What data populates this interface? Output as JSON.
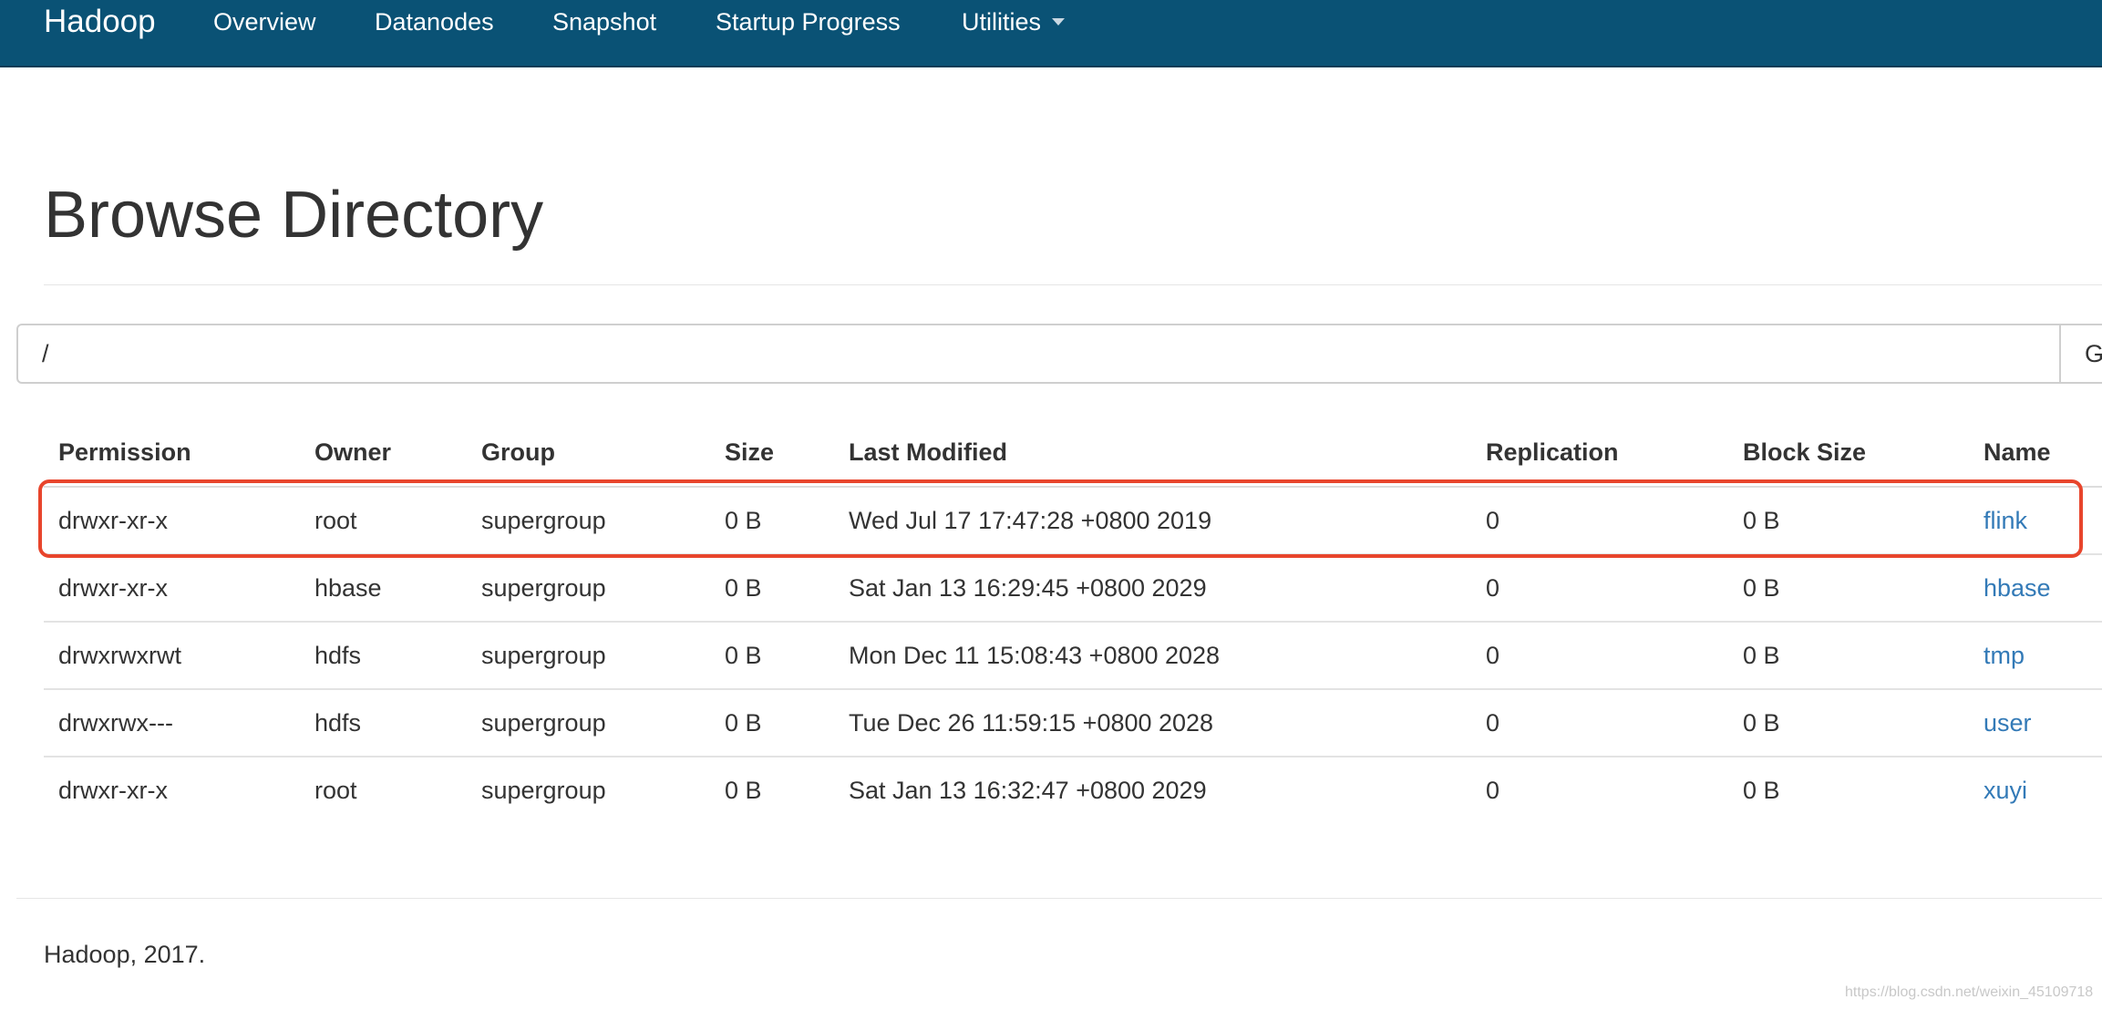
{
  "navbar": {
    "brand": "Hadoop",
    "items": [
      {
        "label": "Overview"
      },
      {
        "label": "Datanodes"
      },
      {
        "label": "Snapshot"
      },
      {
        "label": "Startup Progress"
      },
      {
        "label": "Utilities"
      }
    ],
    "background_color": "#0a5275"
  },
  "page": {
    "title": "Browse Directory"
  },
  "path_bar": {
    "value": "/",
    "go_label": "G"
  },
  "table": {
    "headers": [
      "Permission",
      "Owner",
      "Group",
      "Size",
      "Last Modified",
      "Replication",
      "Block Size",
      "Name"
    ],
    "rows": [
      {
        "permission": "drwxr-xr-x",
        "owner": "root",
        "group": "supergroup",
        "size": "0 B",
        "last_modified": "Wed Jul 17 17:47:28 +0800 2019",
        "replication": "0",
        "block_size": "0 B",
        "name": "flink"
      },
      {
        "permission": "drwxr-xr-x",
        "owner": "hbase",
        "group": "supergroup",
        "size": "0 B",
        "last_modified": "Sat Jan 13 16:29:45 +0800 2029",
        "replication": "0",
        "block_size": "0 B",
        "name": "hbase"
      },
      {
        "permission": "drwxrwxrwt",
        "owner": "hdfs",
        "group": "supergroup",
        "size": "0 B",
        "last_modified": "Mon Dec 11 15:08:43 +0800 2028",
        "replication": "0",
        "block_size": "0 B",
        "name": "tmp"
      },
      {
        "permission": "drwxrwx---",
        "owner": "hdfs",
        "group": "supergroup",
        "size": "0 B",
        "last_modified": "Tue Dec 26 11:59:15 +0800 2028",
        "replication": "0",
        "block_size": "0 B",
        "name": "user"
      },
      {
        "permission": "drwxr-xr-x",
        "owner": "root",
        "group": "supergroup",
        "size": "0 B",
        "last_modified": "Sat Jan 13 16:32:47 +0800 2029",
        "replication": "0",
        "block_size": "0 B",
        "name": "xuyi"
      }
    ],
    "link_color": "#337ab7",
    "highlight_color": "#e8452c"
  },
  "footer": {
    "text": "Hadoop, 2017."
  },
  "watermark": {
    "text": "https://blog.csdn.net/weixin_45109718"
  }
}
